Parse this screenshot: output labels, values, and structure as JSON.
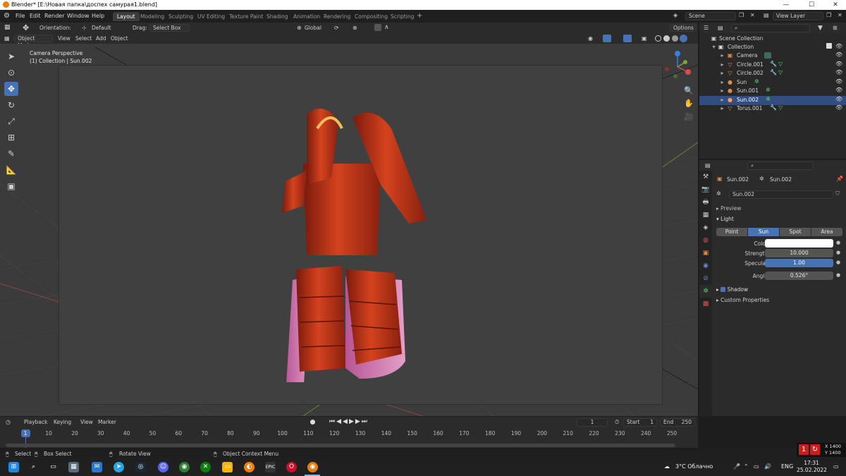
{
  "window": {
    "title": "Blender* [E:\\Новая папка\\доспех самурая1.blend]"
  },
  "menu": [
    "File",
    "Edit",
    "Render",
    "Window",
    "Help"
  ],
  "workspaces": [
    "Layout",
    "Modeling",
    "Sculpting",
    "UV Editing",
    "Texture Paint",
    "Shading",
    "Animation",
    "Rendering",
    "Compositing",
    "Scripting"
  ],
  "active_workspace": "Layout",
  "scene": {
    "name": "Scene",
    "view_layer": "View Layer"
  },
  "tool_header": {
    "orientation_label": "Orientation:",
    "orientation_value": "Default",
    "drag_label": "Drag:",
    "drag_value": "Select Box",
    "transform_orientation": "Global",
    "options_label": "Options"
  },
  "viewport_header": {
    "mode": "Object Mode",
    "menus": [
      "View",
      "Select",
      "Add",
      "Object"
    ]
  },
  "viewport": {
    "line1": "Camera Perspective",
    "line2": "(1) Collection | Sun.002"
  },
  "outliner": {
    "root": "Scene Collection",
    "collection": "Collection",
    "items": [
      "Camera",
      "Circle.001",
      "Circle.002",
      "Sun",
      "Sun.001",
      "Sun.002",
      "Torus.001"
    ]
  },
  "properties": {
    "breadcrumb_object": "Sun.002",
    "breadcrumb_data": "Sun.002",
    "datablock_name": "Sun.002",
    "preview_label": "Preview",
    "light_label": "Light",
    "light_types": [
      "Point",
      "Sun",
      "Spot",
      "Area"
    ],
    "selected_light_type": "Sun",
    "color_label": "Color",
    "color_value": "#ffffff",
    "strength_label": "Strength",
    "strength_value": "10.000",
    "specular_label": "Specular",
    "specular_value": "1.00",
    "angle_label": "Angle",
    "angle_value": "0.526°",
    "shadow_label": "Shadow",
    "custom_props_label": "Custom Properties"
  },
  "timeline": {
    "menus": [
      "Playback",
      "Keying",
      "View",
      "Marker"
    ],
    "current_frame": "1",
    "start_label": "Start",
    "start_value": "1",
    "end_label": "End",
    "end_value": "250",
    "ticks": [
      "1",
      "10",
      "20",
      "30",
      "40",
      "50",
      "60",
      "70",
      "80",
      "90",
      "100",
      "110",
      "120",
      "130",
      "140",
      "150",
      "160",
      "170",
      "180",
      "190",
      "200",
      "210",
      "220",
      "230",
      "240",
      "250"
    ]
  },
  "status": {
    "select": "Select",
    "box_select": "Box Select",
    "rotate_view": "Rotate View",
    "context_menu": "Object Context Menu",
    "resolution_x": "X 1400",
    "resolution_y": "Y 1400"
  },
  "taskbar": {
    "weather": "3°C Облачно",
    "language": "ENG",
    "time": "17:31",
    "date": "25.02.2022",
    "epic_label": "EPIC"
  },
  "colors": {
    "accent": "#4772b3",
    "armor": "#c0331c",
    "skirt": "#d06aa6"
  }
}
